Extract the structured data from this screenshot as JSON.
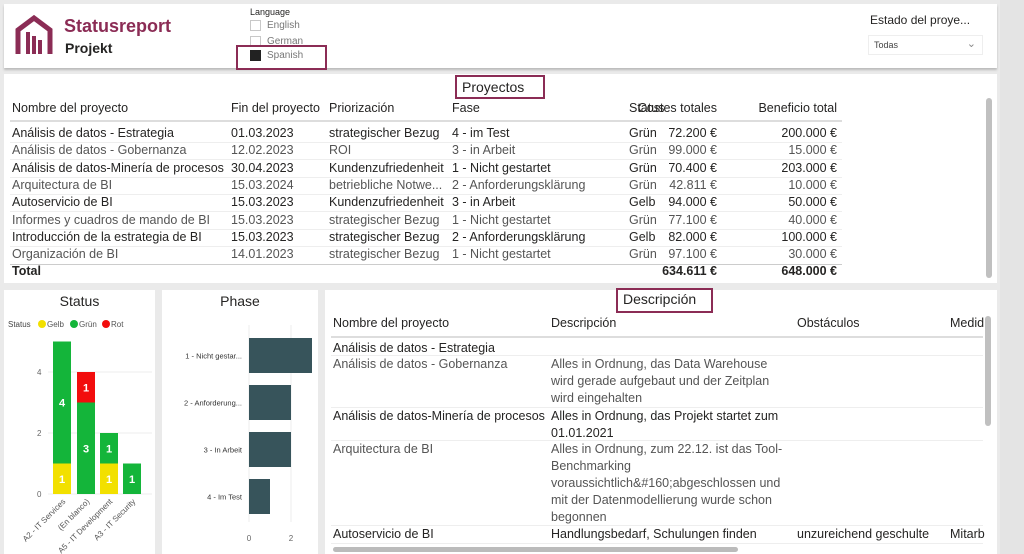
{
  "header": {
    "title": "Statusreport",
    "subtitle": "Projekt",
    "language_label": "Language",
    "languages": [
      {
        "label": "English",
        "checked": false
      },
      {
        "label": "German",
        "checked": false
      },
      {
        "label": "Spanish",
        "checked": true
      }
    ],
    "filter_label": "Estado del proye...",
    "filter_value": "Todas"
  },
  "projects": {
    "title": "Proyectos",
    "columns": [
      "Nombre del proyecto",
      "Fin del proyecto",
      "Priorización",
      "Fase",
      "Status",
      "Costes totales",
      "Beneficio total"
    ],
    "rows": [
      [
        "Análisis de datos - Estrategia",
        "01.03.2023",
        "strategischer Bezug",
        "4 - im Test",
        "Grün",
        "72.200 €",
        "200.000 €"
      ],
      [
        "Análisis de datos - Gobernanza",
        "12.02.2023",
        "ROI",
        "3 - in Arbeit",
        "Grün",
        "99.000 €",
        "15.000 €"
      ],
      [
        "Análisis de datos-Minería de procesos",
        "30.04.2023",
        "Kundenzufriedenheit",
        "1 - Nicht gestartet",
        "Grün",
        "70.400 €",
        "203.000 €"
      ],
      [
        "Arquitectura de BI",
        "15.03.2024",
        "betriebliche Notwe...",
        "2 - Anforderungsklärung",
        "Grün",
        "42.811 €",
        "10.000 €"
      ],
      [
        "Autoservicio de BI",
        "15.03.2023",
        "Kundenzufriedenheit",
        "3 - in Arbeit",
        "Gelb",
        "94.000 €",
        "50.000 €"
      ],
      [
        "Informes y cuadros de mando de BI",
        "15.03.2023",
        "strategischer Bezug",
        "1 - Nicht gestartet",
        "Grün",
        "77.100 €",
        "40.000 €"
      ],
      [
        "Introducción de la estrategia de BI",
        "15.03.2023",
        "strategischer Bezug",
        "2 - Anforderungsklärung",
        "Gelb",
        "82.000 €",
        "100.000 €"
      ],
      [
        "Organización de BI",
        "14.01.2023",
        "strategischer Bezug",
        "1 - Nicht gestartet",
        "Grün",
        "97.100 €",
        "30.000 €"
      ]
    ],
    "total": {
      "label": "Total",
      "costs": "634.611 €",
      "benefit": "648.000 €"
    }
  },
  "description": {
    "title": "Descripción",
    "columns": [
      "Nombre del proyecto",
      "Descripción",
      "Obstáculos",
      "Medid"
    ],
    "rows": [
      [
        "Análisis de datos - Estrategia",
        "",
        "",
        ""
      ],
      [
        "Análisis de datos - Gobernanza",
        "Alles in Ordnung, das Data Warehouse wird gerade aufgebaut und der Zeitplan wird eingehalten",
        "",
        ""
      ],
      [
        "Análisis de datos-Minería de procesos",
        "Alles in Ordnung, das Projekt startet zum 01.01.2021",
        "",
        ""
      ],
      [
        "Arquitectura de BI",
        "Alles in Ordnung, zum 22.12. ist das Tool-Benchmarking voraussichtlich&#160;abgeschlossen und mit der Datenmodellierung wurde schon begonnen",
        "",
        ""
      ],
      [
        "Autoservicio de BI",
        "Handlungsbedarf, Schulungen finden",
        "unzureichend geschulte",
        "Mitarb"
      ]
    ]
  },
  "chart_data": [
    {
      "type": "bar",
      "title": "Status",
      "stacked": true,
      "legend_title": "Status",
      "legend_position": "top-left",
      "categories": [
        "A2 - IT Services",
        "(En blanco)",
        "A5 - IT Development",
        "A3 - IT Security"
      ],
      "series": [
        {
          "name": "Gelb",
          "color": "#f2e000",
          "values": [
            1,
            0,
            1,
            0
          ]
        },
        {
          "name": "Grün",
          "color": "#14b53a",
          "values": [
            4,
            3,
            1,
            1
          ]
        },
        {
          "name": "Rot",
          "color": "#f20d0d",
          "values": [
            0,
            1,
            0,
            0
          ]
        }
      ],
      "yticks": [
        "0",
        "2",
        "4"
      ],
      "ylim": [
        0,
        5
      ]
    },
    {
      "type": "bar",
      "orientation": "horizontal",
      "title": "Phase",
      "color": "#37545b",
      "categories": [
        "1 - Nicht gestar...",
        "2 - Anforderung...",
        "3 - In Arbeit",
        "4 - Im Test"
      ],
      "values": [
        3,
        2,
        2,
        1
      ],
      "xticks": [
        "0",
        "2"
      ],
      "xlim": [
        0,
        3
      ]
    }
  ]
}
